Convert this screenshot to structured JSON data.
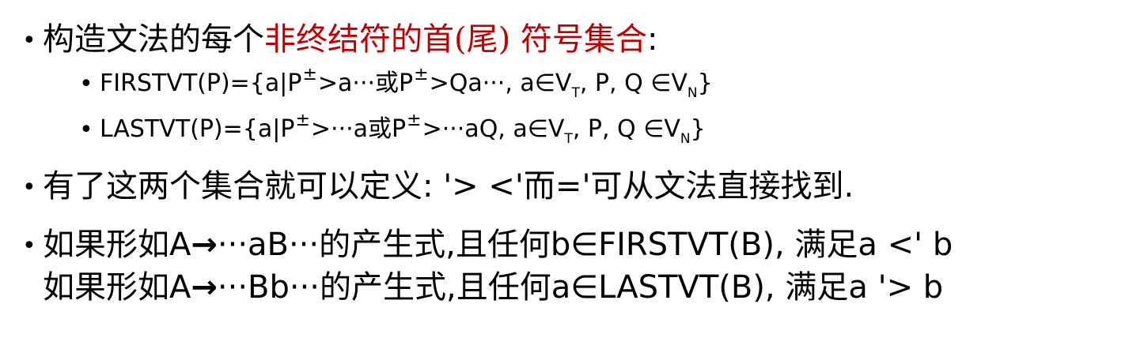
{
  "line1": {
    "bullet": "•",
    "prefix": "构造文法的每个",
    "highlight": "非终结符的首(尾) 符号集合",
    "suffix": ":"
  },
  "firstvt": {
    "bullet": "•",
    "p1": "FIRSTVT(P)={a|P",
    "pm1": "±",
    "p2": ">a···或P",
    "pm2": "±",
    "p3": ">Qa···, a∈V",
    "sub1": "T",
    "p4": ",  P,  Q ∈V",
    "sub2": "N",
    "p5": "}"
  },
  "lastvt": {
    "bullet": "•",
    "p1": "LASTVT(P)={a|P",
    "pm1": "±",
    "p2": ">···a或P",
    "pm2": "±",
    "p3": ">···aQ, a∈V",
    "sub1": "T",
    "p4": ",  P,  Q ∈V",
    "sub2": "N",
    "p5": "}"
  },
  "line4": {
    "bullet": "•",
    "text": "有了这两个集合就可以定义:  '>  <'而='可从文法直接找到."
  },
  "line5": {
    "bullet": "•",
    "p1": "如果形如A",
    "arrow": "→",
    "p2": "···aB···的产生式,且任何b∈FIRSTVT(B), 满足a <' b"
  },
  "line6": {
    "p1": "如果形如A",
    "arrow": "→",
    "p2": "···Bb···的产生式,且任何a∈LASTVT(B), 满足a '> b"
  }
}
